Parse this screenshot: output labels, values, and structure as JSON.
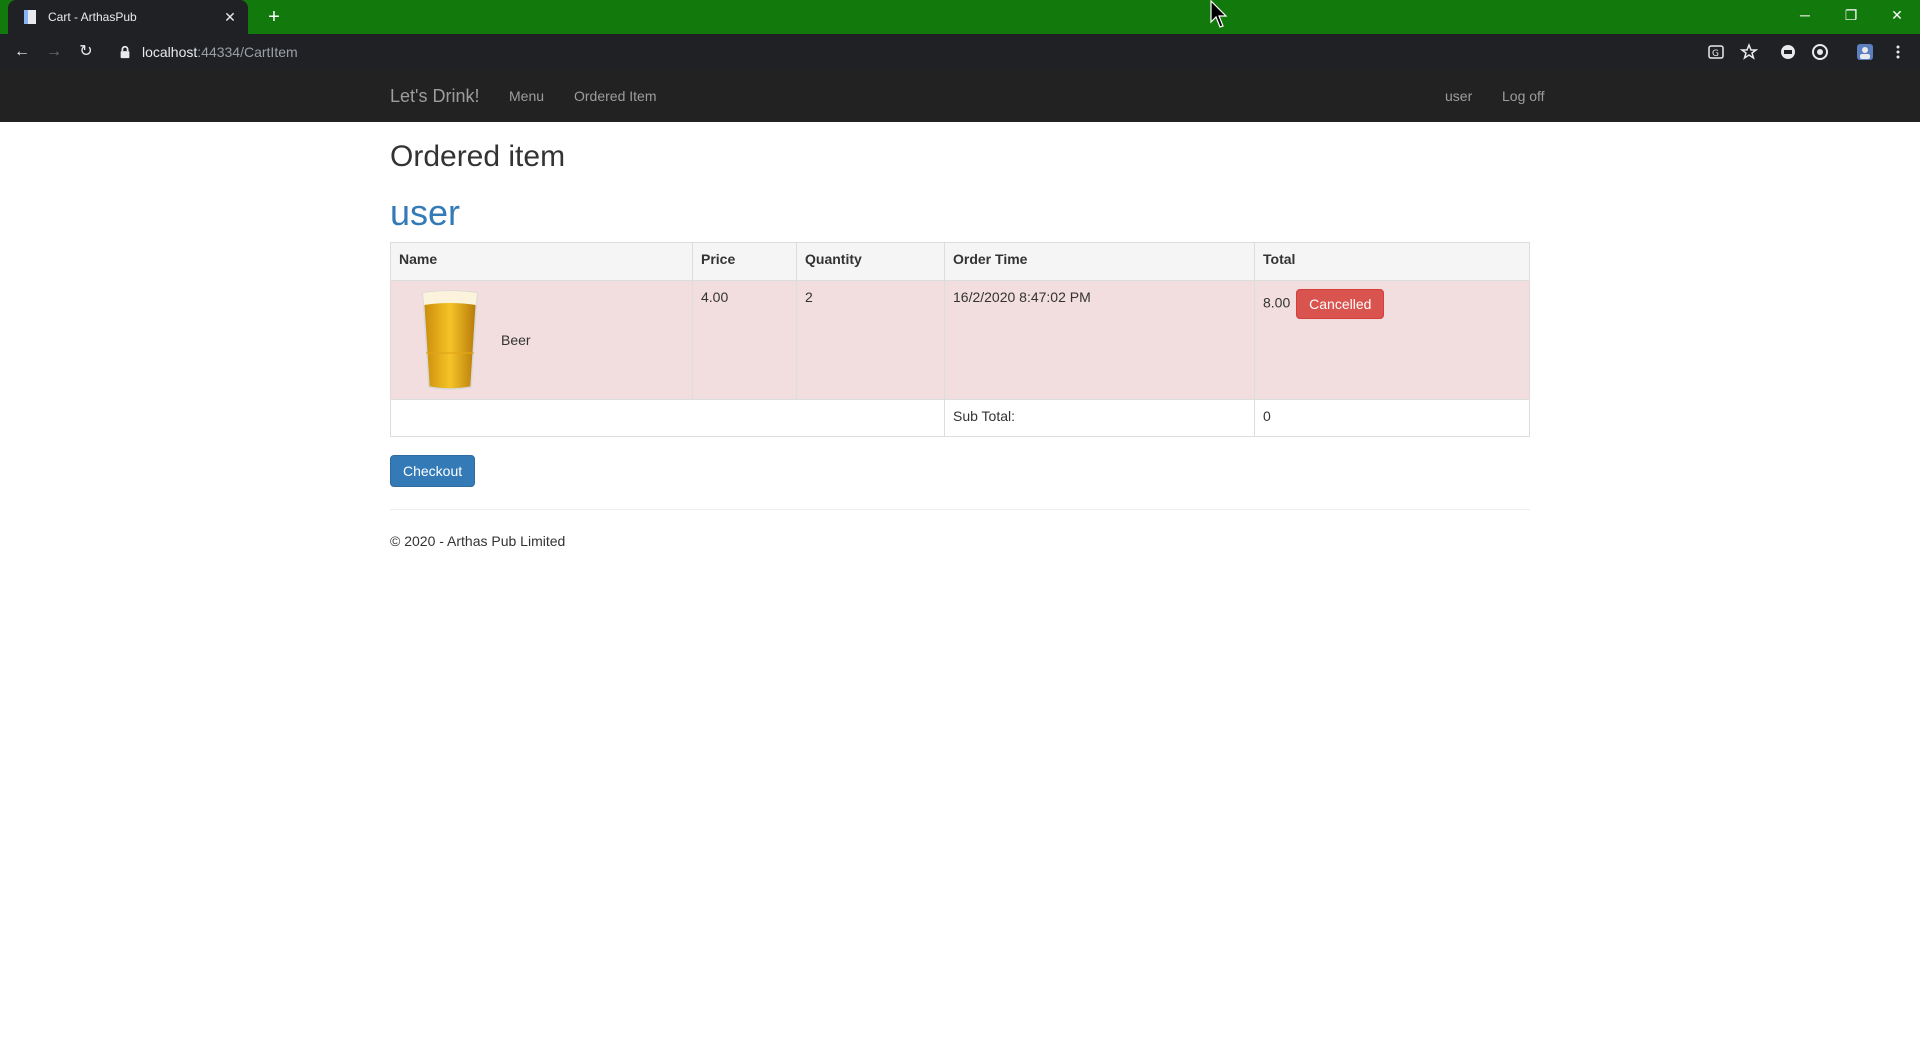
{
  "browser": {
    "tab_title": "Cart - ArthasPub",
    "tab_close": "✕",
    "new_tab": "+",
    "url_host": "localhost",
    "url_rest": ":44334/CartItem",
    "window_controls": {
      "minimize": "─",
      "restore": "❐",
      "close": "✕"
    },
    "nav": {
      "back": "←",
      "forward": "→",
      "reload": "↻"
    },
    "frame_color": "#127a0d"
  },
  "navbar": {
    "brand": "Let's Drink!",
    "links": [
      "Menu",
      "Ordered Item"
    ],
    "right_links": [
      "user",
      "Log off"
    ]
  },
  "page": {
    "title": "Ordered item",
    "user_heading": "user"
  },
  "cart": {
    "headers": [
      "Name",
      "Price",
      "Quantity",
      "Order Time",
      "Total"
    ],
    "rows": [
      {
        "image_icon": "beer-glass-icon",
        "name": "Beer",
        "price": "4.00",
        "quantity": "2",
        "order_time": "16/2/2020 8:47:02 PM",
        "total": "8.00",
        "status": "Cancelled"
      }
    ],
    "subtotal_label": "Sub Total:",
    "subtotal_value": "0"
  },
  "actions": {
    "checkout": "Checkout"
  },
  "footer": {
    "text": "© 2020 - Arthas Pub Limited"
  },
  "colors": {
    "danger": "#d9534f",
    "primary": "#337ab7",
    "row_danger_bg": "#f2dede"
  }
}
